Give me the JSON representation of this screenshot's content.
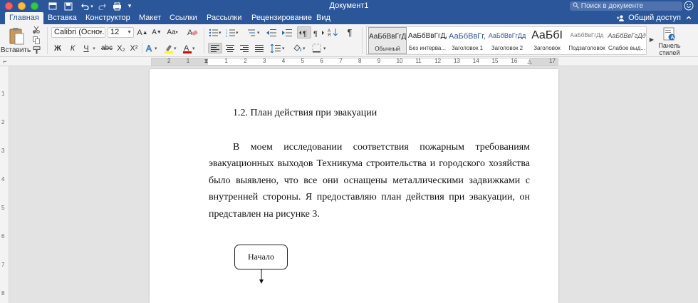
{
  "window": {
    "document_title": "Документ1",
    "search_placeholder": "Поиск в документе",
    "share_label": "Общий доступ"
  },
  "tabs": [
    {
      "label": "Главная",
      "active": true
    },
    {
      "label": "Вставка"
    },
    {
      "label": "Конструктор"
    },
    {
      "label": "Макет"
    },
    {
      "label": "Ссылки"
    },
    {
      "label": "Рассылки"
    },
    {
      "label": "Рецензирование"
    },
    {
      "label": "Вид"
    }
  ],
  "ribbon": {
    "paste_label": "Вставить",
    "font_name": "Calibri (Осно...",
    "font_size": "12",
    "bold": "Ж",
    "italic": "К",
    "underline": "Ч",
    "strikethrough": "abc",
    "subscript": "X₂",
    "superscript": "X²",
    "styles_pane_label_1": "Панель",
    "styles_pane_label_2": "стилей",
    "styles": [
      {
        "sample": "АаБбВвГгДд",
        "name": "Обычный",
        "selected": true
      },
      {
        "sample": "АаБбВвГгДд",
        "name": "Без интерва..."
      },
      {
        "sample": "АаБбВвГг,",
        "name": "Заголовок 1"
      },
      {
        "sample": "АаБбВвГгДд",
        "name": "Заголовок 2"
      },
      {
        "sample": "АаБбI",
        "name": "Заголовок"
      },
      {
        "sample": "АаБбВвГгДд",
        "name": "Подзаголовок"
      },
      {
        "sample": "АаБбВвГгДд",
        "name": "Слабое выд..."
      }
    ]
  },
  "ruler": {
    "numbers": [
      "2",
      "1",
      "",
      "1",
      "2",
      "3",
      "4",
      "5",
      "6",
      "7",
      "8",
      "9",
      "10",
      "11",
      "12",
      "13",
      "14",
      "15",
      "16",
      "",
      "17"
    ]
  },
  "vruler": {
    "numbers": [
      "1",
      "2",
      "3",
      "4",
      "5",
      "6",
      "7",
      "8"
    ]
  },
  "document": {
    "heading": "1.2. План действия при эвакуации",
    "paragraph": "В моем исследовании соответствия пожарным требованиям эвакуационных выходов Техникума строительства и городского хозяйства было выявлено, что все они оснащены металлическими задвижками с внутренней стороны. Я предоставляю план действия при эвакуации, он представлен на рисунке 3.",
    "flow_start_label": "Начало"
  },
  "colors": {
    "brand": "#2b579a",
    "highlight": "#ffff00",
    "font_color": "#e00000"
  }
}
